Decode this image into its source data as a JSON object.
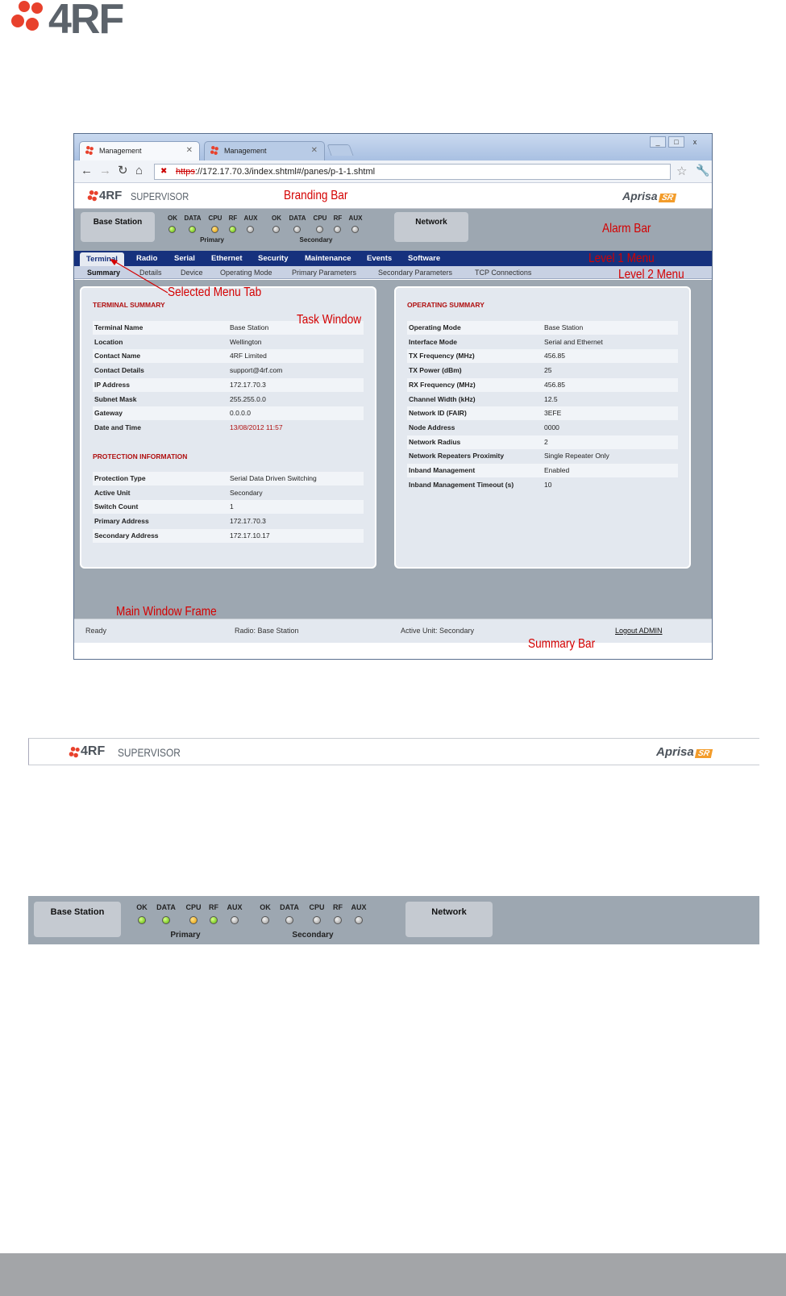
{
  "page_logo": {
    "text": "4RF"
  },
  "browser": {
    "tabs": [
      {
        "label": "Management"
      },
      {
        "label": "Management"
      }
    ],
    "url": {
      "scheme": "https",
      "rest": "://172.17.70.3/index.shtml#/panes/p-1-1.shtml"
    },
    "window_buttons": [
      "_",
      "□",
      "x"
    ]
  },
  "branding": {
    "logo": "4RF",
    "product": "SUPERVISOR",
    "aprisa": "Aprisa",
    "sr": "SR"
  },
  "alarm_bar": {
    "base_station": "Base Station",
    "network": "Network",
    "primary": {
      "label": "Primary",
      "leds": [
        {
          "name": "OK",
          "color": "green"
        },
        {
          "name": "DATA",
          "color": "green"
        },
        {
          "name": "CPU",
          "color": "orange"
        },
        {
          "name": "RF",
          "color": "green"
        },
        {
          "name": "AUX",
          "color": "grey"
        }
      ]
    },
    "secondary": {
      "label": "Secondary",
      "leds": [
        {
          "name": "OK",
          "color": "grey"
        },
        {
          "name": "DATA",
          "color": "grey"
        },
        {
          "name": "CPU",
          "color": "grey"
        },
        {
          "name": "RF",
          "color": "grey"
        },
        {
          "name": "AUX",
          "color": "grey"
        }
      ]
    }
  },
  "menu1": [
    "Terminal",
    "Radio",
    "Serial",
    "Ethernet",
    "Security",
    "Maintenance",
    "Events",
    "Software"
  ],
  "menu2": [
    "Summary",
    "Details",
    "Device",
    "Operating Mode",
    "Primary Parameters",
    "Secondary Parameters",
    "TCP Connections"
  ],
  "terminal_summary": {
    "title": "TERMINAL SUMMARY",
    "rows": [
      {
        "k": "Terminal Name",
        "v": "Base Station"
      },
      {
        "k": "Location",
        "v": "Wellington"
      },
      {
        "k": "Contact Name",
        "v": "4RF Limited"
      },
      {
        "k": "Contact Details",
        "v": "support@4rf.com"
      },
      {
        "k": "IP Address",
        "v": "172.17.70.3"
      },
      {
        "k": "Subnet Mask",
        "v": "255.255.0.0"
      },
      {
        "k": "Gateway",
        "v": "0.0.0.0"
      },
      {
        "k": "Date and Time",
        "v": "13/08/2012 11:57"
      }
    ]
  },
  "protection_info": {
    "title": "PROTECTION INFORMATION",
    "rows": [
      {
        "k": "Protection Type",
        "v": "Serial Data Driven Switching"
      },
      {
        "k": "Active Unit",
        "v": "Secondary"
      },
      {
        "k": "Switch Count",
        "v": "1"
      },
      {
        "k": "Primary Address",
        "v": "172.17.70.3"
      },
      {
        "k": "Secondary Address",
        "v": "172.17.10.17"
      }
    ]
  },
  "operating_summary": {
    "title": "OPERATING SUMMARY",
    "rows": [
      {
        "k": "Operating Mode",
        "v": "Base Station"
      },
      {
        "k": "Interface Mode",
        "v": "Serial and Ethernet"
      },
      {
        "k": "TX Frequency (MHz)",
        "v": "456.85"
      },
      {
        "k": "TX Power (dBm)",
        "v": "25"
      },
      {
        "k": "RX Frequency (MHz)",
        "v": "456.85"
      },
      {
        "k": "Channel Width (kHz)",
        "v": "12.5"
      },
      {
        "k": "Network ID (FAIR)",
        "v": "3EFE"
      },
      {
        "k": "Node Address",
        "v": "0000"
      },
      {
        "k": "Network Radius",
        "v": "2"
      },
      {
        "k": "Network Repeaters Proximity",
        "v": "Single Repeater Only"
      },
      {
        "k": "Inband Management",
        "v": "Enabled"
      },
      {
        "k": "Inband Management Timeout (s)",
        "v": "10"
      }
    ]
  },
  "summary_bar": {
    "ready": "Ready",
    "radio": "Radio: Base Station",
    "active_unit": "Active Unit: Secondary",
    "logout": "Logout ADMIN"
  },
  "annotations": {
    "branding_bar": "Branding Bar",
    "alarm_bar": "Alarm Bar",
    "level1": "Level 1 Menu",
    "level2": "Level 2 Menu",
    "selected_tab": "Selected Menu Tab",
    "task_window": "Task Window",
    "main_window_frame": "Main Window Frame",
    "summary_bar": "Summary Bar"
  },
  "colors": {
    "menu_blue": "#16317d",
    "annotation_red": "#d40000",
    "frame_grey": "#9da7b1",
    "section_red": "#b01010",
    "led_green": "#58b400",
    "led_orange": "#e39a00"
  }
}
